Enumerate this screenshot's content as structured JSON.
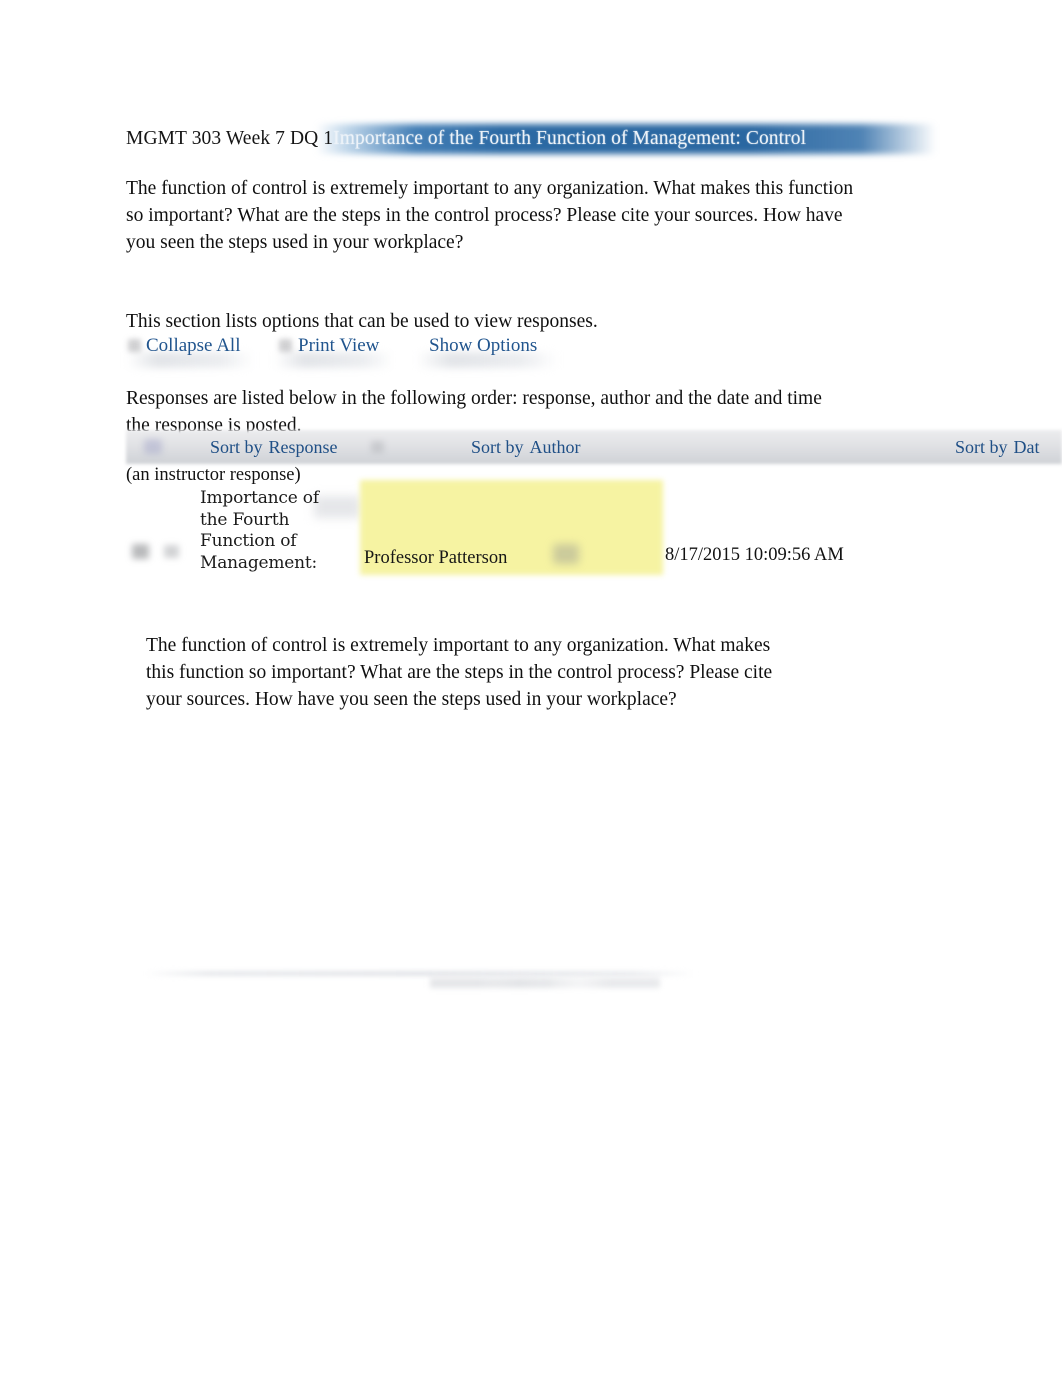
{
  "document": {
    "title_prefix": "MGMT 303 Week 7 DQ 1",
    "title_banner": "Importance of the Fourth Function of Management: Control",
    "prompt": "The function of control is extremely important to any organization. What makes this function so important? What are the steps in the control process? Please cite your sources. How have you seen the steps used in your workplace?"
  },
  "options": {
    "section_note": "This section lists options that can be used to view responses.",
    "collapse_all": "Collapse All",
    "print_view": "Print View",
    "show_options": "Show Options"
  },
  "responses_section": {
    "order_note": "Responses are listed below in the following order: response, author and the date and time the response is posted.",
    "sort_prefix": "Sort by",
    "sort_response": "Response",
    "sort_author": "Author",
    "sort_date": "Dat",
    "instructor_note": "(an instructor response)"
  },
  "response": {
    "title": "Importance of the Fourth Function of Management:",
    "author": "Professor Patterson",
    "datetime": "8/17/2015 10:09:56 AM",
    "body": "The function of control is extremely important to any organization. What makes this function so important? What are the steps in the control process? Please cite your sources. How have you seen the steps used in your workplace?"
  },
  "colors": {
    "banner_blue": "#2c6aa4",
    "link_blue": "#21558e",
    "sort_link_blue": "#1f4f86",
    "highlight_yellow": "#f6f3a2",
    "sort_bar_gray": "#e2e3e6",
    "text_black": "#101010"
  }
}
